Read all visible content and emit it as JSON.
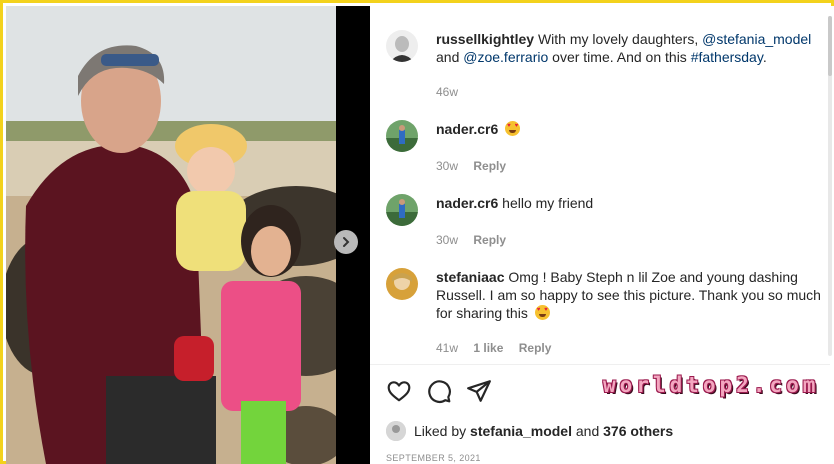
{
  "post": {
    "caption": {
      "username": "russellkightley",
      "text_before": "With my lovely daughters, ",
      "mention1": "@stefania_model",
      "text_mid": " and ",
      "mention2": "@zoe.ferrario",
      "text_after": " over time. And on this ",
      "hashtag": "#fathersday",
      "text_end": ".",
      "time": "46w"
    },
    "comments": [
      {
        "username": "nader.cr6",
        "text": "",
        "time": "30w",
        "reply": "Reply",
        "emoji": "heart-eyes-emoji"
      },
      {
        "username": "nader.cr6",
        "text": "hello my friend",
        "time": "30w",
        "reply": "Reply"
      },
      {
        "username": "stefaniaac",
        "text": "Omg ! Baby Steph n lil Zoe and young dashing Russell. I am so happy to see this picture. Thank you so much for sharing this",
        "time": "41w",
        "likes": "1 like",
        "reply": "Reply",
        "emoji": "heart-eyes-emoji"
      }
    ],
    "liked_by": {
      "prefix": "Liked by ",
      "user": "stefania_model",
      "mid": " and ",
      "others": "376 others"
    },
    "date": "SEPTEMBER 5, 2021"
  },
  "watermark": "worldtop2.com",
  "colors": {
    "border": "#f3d21c",
    "link": "#00376b",
    "muted": "#8e8e8e"
  },
  "icons": [
    "heart-icon",
    "comment-icon",
    "share-icon",
    "next-arrow-icon"
  ]
}
